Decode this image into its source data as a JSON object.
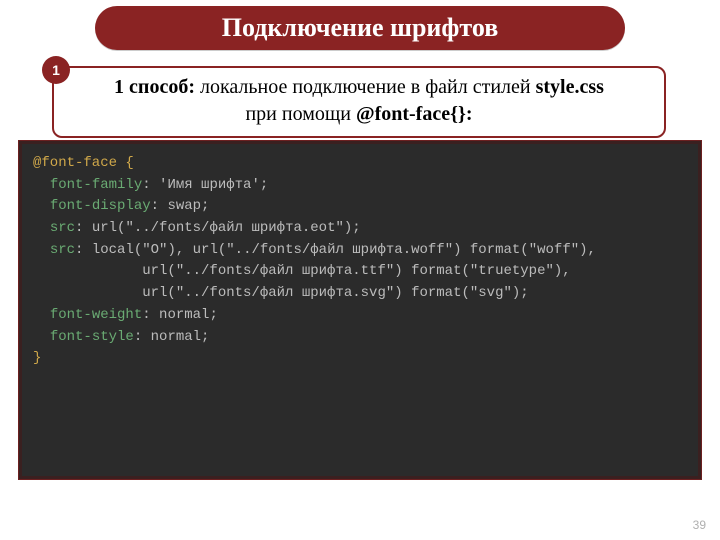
{
  "title": "Подключение шрифтов",
  "badge": "1",
  "subtitle": {
    "lead": "1 способ:",
    "rest1": " локальное подключение в файл стилей ",
    "file": "style.css",
    "line2_a": "при помощи ",
    "line2_b": "@font-face{}:"
  },
  "code": {
    "l1_rule": "@font-face",
    "l1_brace": " {",
    "l2_prop": "font-family",
    "l2_val": " 'Имя шрифта';",
    "l3_prop": "font-display",
    "l3_val": " swap;",
    "l4_prop": "src",
    "l4_val": " url(\"../fonts/файл шрифта.eot\");",
    "l5_prop": "src",
    "l5_val": " local(\"O\"), url(\"../fonts/файл шрифта.woff\") format(\"woff\"),",
    "l6_val": "url(\"../fonts/файл шрифта.ttf\") format(\"truetype\"),",
    "l7_val": "url(\"../fonts/файл шрифта.svg\") format(\"svg\");",
    "l8_prop": "font-weight",
    "l8_val": " normal;",
    "l9_prop": "font-style",
    "l9_val": " normal;",
    "l10_brace": "}"
  },
  "page_number": "39"
}
